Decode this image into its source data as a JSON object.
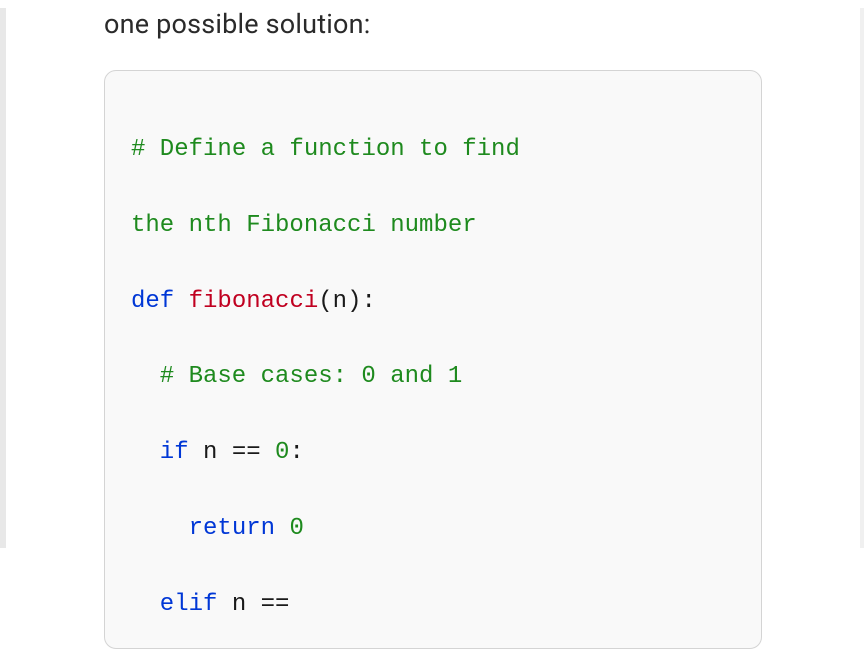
{
  "intro": "one possible solution:",
  "code": {
    "line1_comment_a": "# Define a function to find",
    "line1_comment_b": "the nth Fibonacci number",
    "line2_def": "def",
    "line2_func": "fibonacci",
    "line2_paren_open": "(",
    "line2_param": "n",
    "line2_paren_close": "):",
    "line3_comment": "# Base cases: 0 and 1",
    "line4_if": "if",
    "line4_cond_var": "n",
    "line4_cond_op": "==",
    "line4_cond_val": "0",
    "line4_colon": ":",
    "line5_return": "return",
    "line5_val": "0",
    "line6_elif": "elif",
    "line6_var": "n",
    "line6_op": "=="
  }
}
